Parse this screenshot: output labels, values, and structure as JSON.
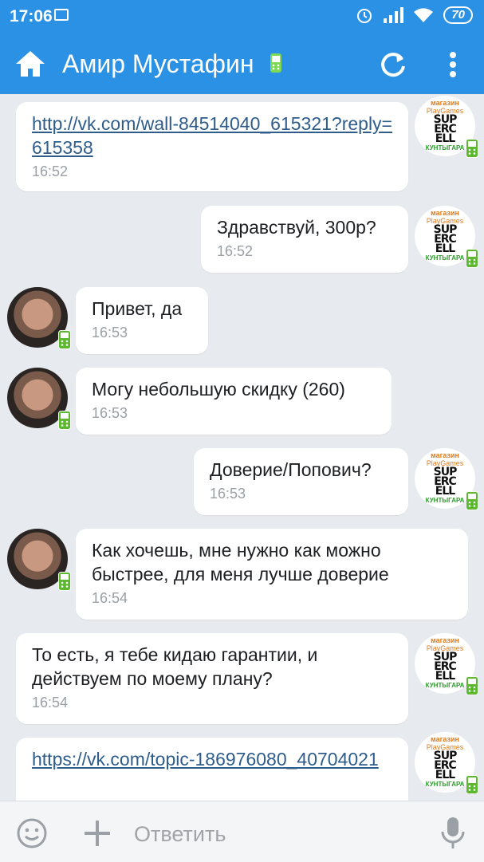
{
  "status": {
    "time": "17:06",
    "battery": "70"
  },
  "header": {
    "title": "Амир Мустафин"
  },
  "colors": {
    "accent": "#2a91e4",
    "link": "#2e5d8c",
    "badge_green": "#5cb82e"
  },
  "icons": {
    "home": "home-icon",
    "refresh": "refresh-icon",
    "menu": "more-vert-icon",
    "emoji": "emoji-icon",
    "attach": "plus-icon",
    "mic": "mic-icon"
  },
  "shop_logo": {
    "line1": "магазин",
    "line2": "PlayGames",
    "main": "SUP ERC ELL",
    "bottom": "КУНТЫГАРА"
  },
  "messages": [
    {
      "side": "right",
      "text": "http://vk.com/wall-84514040_615321?reply=615358",
      "is_link": true,
      "time": "16:52"
    },
    {
      "side": "right",
      "text": "Здравствуй, 300р?",
      "is_link": false,
      "time": "16:52"
    },
    {
      "side": "left",
      "text": "Привет, да",
      "is_link": false,
      "time": "16:53"
    },
    {
      "side": "left",
      "text": "Могу небольшую скидку (260)",
      "is_link": false,
      "time": "16:53"
    },
    {
      "side": "right",
      "text": "Доверие/Попович?",
      "is_link": false,
      "time": "16:53"
    },
    {
      "side": "left",
      "text": "Как хочешь, мне нужно как можно быстрее, для меня лучше доверие",
      "is_link": false,
      "time": "16:54"
    },
    {
      "side": "right",
      "text": "То есть, я тебе кидаю гарантии, и действуем по моему плану?",
      "is_link": false,
      "time": "16:54"
    },
    {
      "side": "right",
      "text": "https://vk.com/topic-186976080_40704021",
      "is_link": true,
      "time": ""
    }
  ],
  "composer": {
    "placeholder": "Ответить"
  }
}
